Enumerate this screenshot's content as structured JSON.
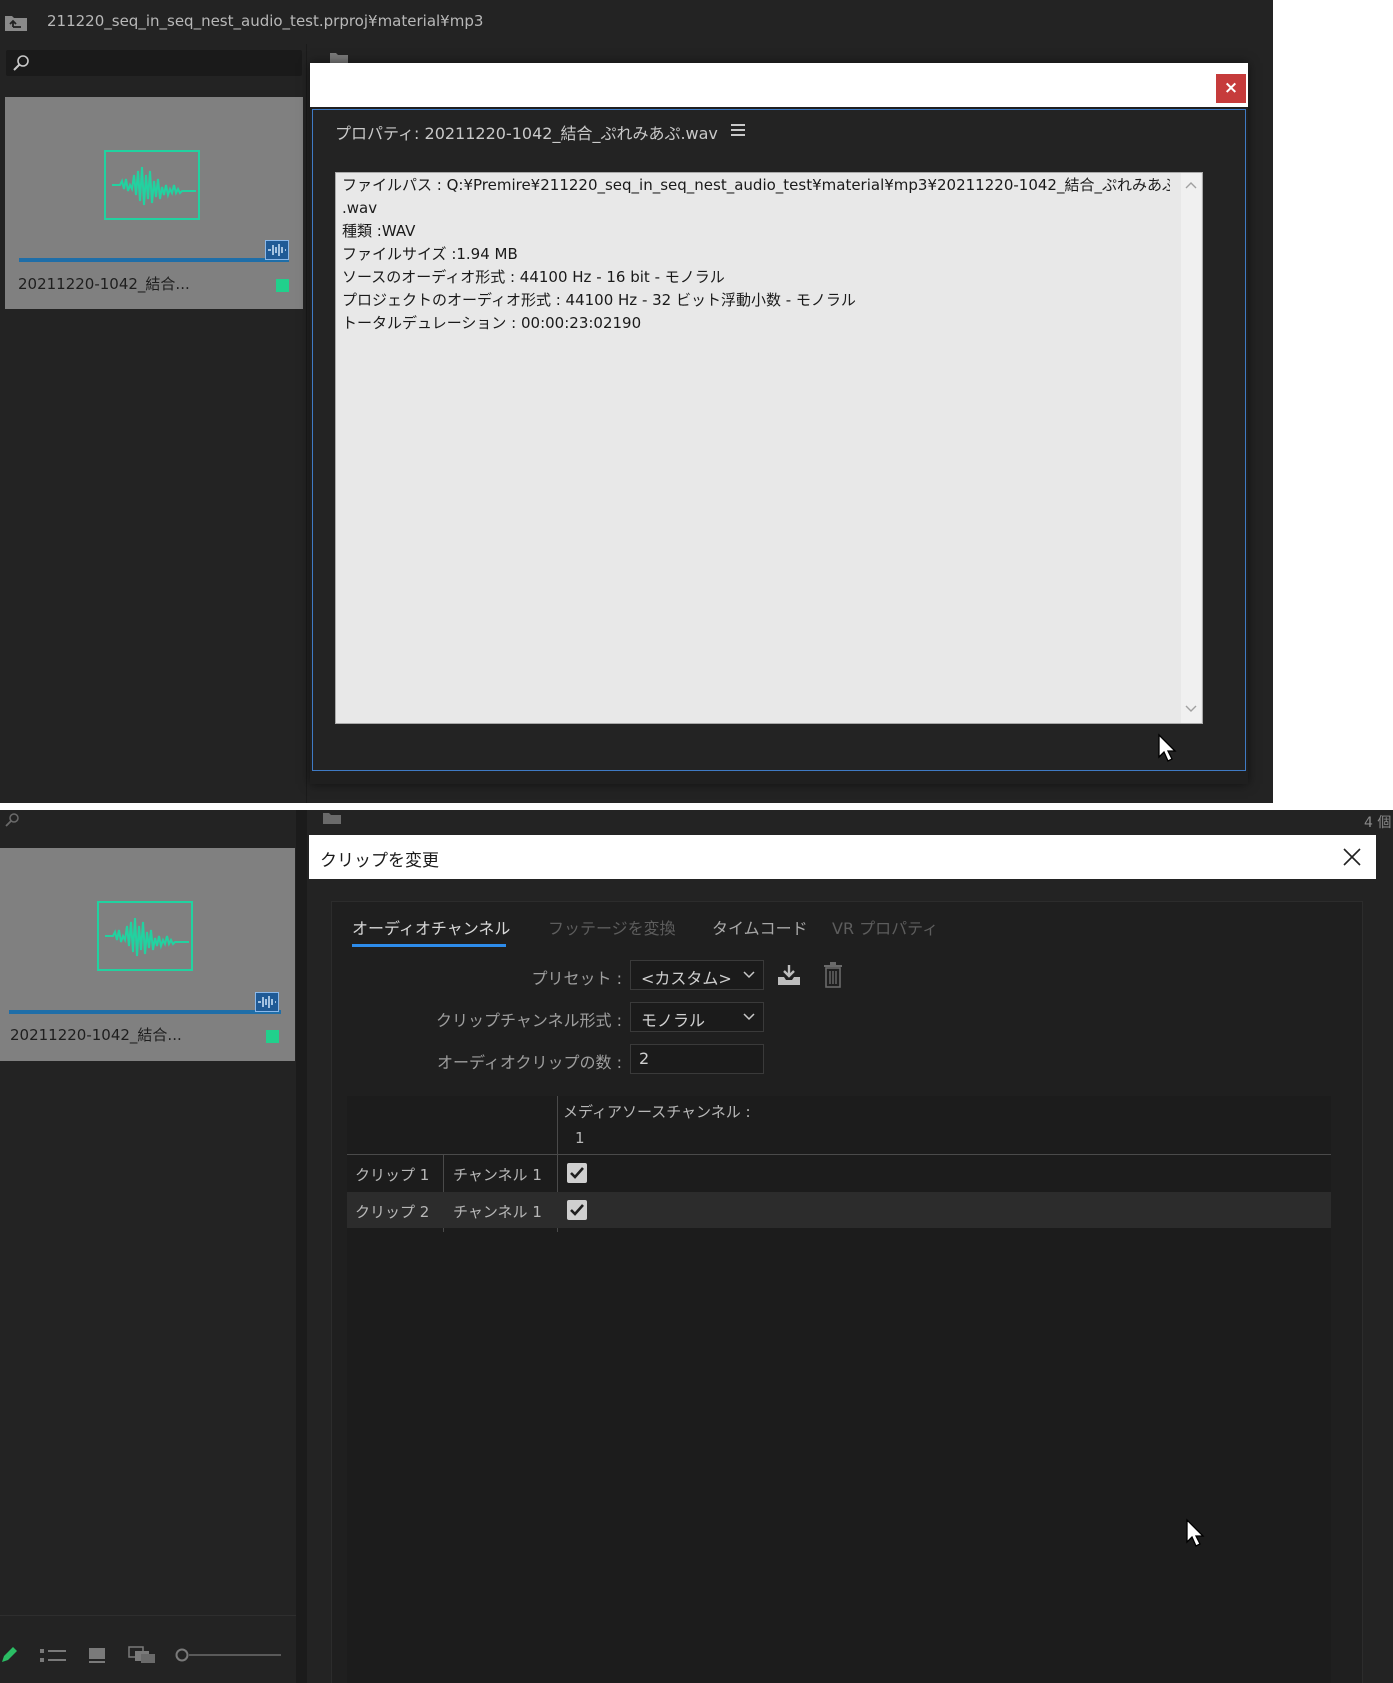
{
  "top": {
    "path": "211220_seq_in_seq_nest_audio_test.prproj¥material¥mp3",
    "search_placeholder": "",
    "clip": {
      "name": "20211220-1042_結合..."
    },
    "dialog": {
      "close_label": "×",
      "panel_title": "プロパティ:  20211220-1042_結合_ぷれみあぷ.wav",
      "lines": [
        "ファイルパス : Q:¥Premire¥211220_seq_in_seq_nest_audio_test¥material¥mp3¥20211220-1042_結合_ぷれみあぷ",
        ".wav",
        "種類 :WAV",
        "ファイルサイズ :1.94 MB",
        "ソースのオーディオ形式 : 44100 Hz - 16 bit - モノラル",
        "プロジェクトのオーディオ形式 : 44100 Hz - 32 ビット浮動小数 - モノラル",
        "トータルデュレーション : 00:00:23:02190"
      ]
    }
  },
  "bottom": {
    "corner_count": "4 個",
    "clip": {
      "name": "20211220-1042_結合..."
    },
    "dialog": {
      "title": "クリップを変更",
      "tabs": [
        "オーディオチャンネル",
        "フッテージを変換",
        "タイムコード",
        "VR プロパティ"
      ],
      "preset_label": "プリセット :",
      "preset_value": "<カスタム>",
      "channel_format_label": "クリップチャンネル形式 :",
      "channel_format_value": "モノラル",
      "clip_count_label": "オーディオクリップの数 :",
      "clip_count_value": "2",
      "grid": {
        "source_header": "メディアソースチャンネル :",
        "source_channel": "1",
        "rows": [
          {
            "clip": "クリップ 1",
            "channel": "チャンネル 1",
            "checked": true
          },
          {
            "clip": "クリップ 2",
            "channel": "チャンネル 1",
            "checked": true
          }
        ]
      }
    }
  },
  "colors": {
    "panel_bg": "#232323",
    "accent_blue": "#2d8ceb",
    "waveform_green": "#22d2a0",
    "close_red": "#c63b3b"
  },
  "icons": [
    "folder-up-icon",
    "search-icon",
    "folder-icon",
    "waveform-icon",
    "audio-clip-icon",
    "menu-icon",
    "close-icon",
    "chevron-down-icon",
    "download-icon",
    "trash-icon",
    "check-icon",
    "mouse-cursor-icon",
    "pencil-icon",
    "list-view-icon",
    "icon-view-icon",
    "freeform-view-icon",
    "zoom-slider-icon"
  ]
}
